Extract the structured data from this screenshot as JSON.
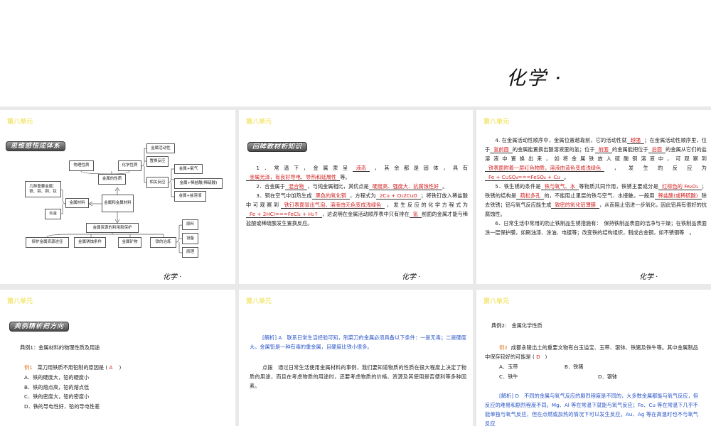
{
  "top": {
    "footer": "化学 ·"
  },
  "unit": "第八单元",
  "footer": "化学 ·",
  "slide1": {
    "badge": "思维感悟成体系",
    "boxes": {
      "activity": "金属活动性",
      "physical": "物理性质",
      "chemical": "化学性质",
      "replace": "置换反应",
      "oxygen": "金属+氧气",
      "props": "金属的性质",
      "reactions": "相关反应",
      "acid": "金属+稀盐酸(稀硫酸)",
      "metals": "几种重要金属：铁、铝、铜、钛",
      "salt": "金属+盐溶液",
      "center": "金属和金属材料",
      "materials": "金属材料",
      "alloy": "合金",
      "resources": "金属资源的利用和保护",
      "raw": "原料",
      "protect": "保护金属资源途径",
      "rust": "金属锈蚀条件",
      "ore": "金属矿物",
      "smelt": "铁的冶炼",
      "equipment": "设备",
      "principle": "原理"
    }
  },
  "slide2": {
    "badge": "回眸教材析知识",
    "paragraphs": [
      [
        {
          "t": "1．常温下，金属汞呈"
        },
        {
          "a": "液态"
        },
        {
          "t": "，其余都是固体，具有"
        },
        {
          "a": "金属光泽，有良好导电、导热和延展性"
        },
        {
          "t": "等。"
        }
      ],
      [
        {
          "t": "2．合金属于"
        },
        {
          "a": "混合物"
        },
        {
          "t": "，与纯金属相比，其优点是"
        },
        {
          "a": "硬度高、强度大、抗腐蚀性好"
        },
        {
          "t": "。"
        }
      ],
      [
        {
          "t": "3．铜在空气中加热生成"
        },
        {
          "a": "黑色的氧化铜"
        },
        {
          "t": "，方程式为"
        },
        {
          "a": "2Cu + O₂2CuO"
        },
        {
          "t": "；将铁钉放入稀盐酸中可观察到"
        },
        {
          "a": "铁钉表面冒出气泡，溶液由无色变成浅绿色"
        },
        {
          "t": "，发生反应的化学方程式为"
        },
        {
          "a": "Fe + 2HCl===FeCl₂ + H₂↑"
        },
        {
          "t": "，这说明在金属活动顺序表中只有排在"
        },
        {
          "a": "氢"
        },
        {
          "t": "前面的金属才能与稀盐酸或稀硫酸发生置换反应。"
        }
      ]
    ]
  },
  "slide3": {
    "paragraphs": [
      [
        {
          "t": "4. 在金属活动性顺序中，金属位置越靠前，它的活动性就"
        },
        {
          "a": "越强"
        },
        {
          "t": "；在金属活动性顺序里，位于"
        },
        {
          "a": "氢前面"
        },
        {
          "t": "的金属能置换出酸溶液里的氢；位于"
        },
        {
          "a": "前面"
        },
        {
          "t": "的金属能把位于"
        },
        {
          "a": "后面"
        },
        {
          "t": "的金属从它们的盐溶液中置换出来，如将金属铁放入硫酸铜溶液中，可观察到"
        },
        {
          "a": "铁表面附着一层红色物质，溶液由蓝色变成浅绿色"
        },
        {
          "t": "，发生的反应为"
        },
        {
          "a": "Fe + CuSO₄===FeSO₄ + Cu"
        },
        {
          "t": "。"
        }
      ],
      [
        {
          "t": "5．铁生锈的条件是"
        },
        {
          "a": "铁与氧气、水"
        },
        {
          "t": "等物质共同作用，铁锈主要成分是"
        },
        {
          "a": "红棕色的 Fe₂O₃"
        },
        {
          "t": "；铁锈的结构是"
        },
        {
          "a": "疏松多孔"
        },
        {
          "t": "的，不能阻止里层的铁与空气、水接触，一般用"
        },
        {
          "a": "稀盐酸(或稀硫酸)"
        },
        {
          "t": "除去铁锈；铝与氧气反应能生成"
        },
        {
          "a": "致密的氧化铝薄膜"
        },
        {
          "t": "，从而阻止铝进一步氧化，因此铝具有很好的抗腐蚀性。"
        }
      ],
      [
        {
          "t": "6．日常生活中常用的防止铁制品生锈措施有：　保持铁制品表面的洁净与干燥；在铁制品表面涂一层保护膜，如刷油漆、涂油、电镀等；改变铁的结构组织，制成合金钢，如不锈钢等　。"
        }
      ]
    ]
  },
  "slide4": {
    "badge": "典例精析把方向",
    "topic": "典例1：金属材料的物理性质及用途",
    "q_label": "例1",
    "question": "菜刀用铁质不用铅制的原因是 (",
    "answer": "A",
    "close": ")",
    "options": [
      "A．铁的硬度大，铅的硬度小",
      "B．铁的熔点高，铅的熔点低",
      "C．铁的密度大，铅的密度小",
      "D．铁的导电性好，铅的导电性差"
    ]
  },
  "slide5": {
    "analysis": "[解析] A　联系日常生活经验可知，制菜刀的金属必须具备以下条件：一是无毒；二是硬度大。金属铅是一种有毒的重金属，且硬度比铁小很多。",
    "tip": "点拨　通过日常生活使用金属材料的事例，我们要知道物质的性质在很大程度上决定了物质的用途，而且在考虑物质的用途时，还要考虑物质的价格、资源及其使用是否便利等多种因素。"
  },
  "slide6": {
    "topic": "典例2:　金属化学性质",
    "q_label": "例2",
    "question": "成都永陵出土的重要文物有白玉谥宝、玉带、银钵、铁猪及铁牛等。其中金属制品中保存较好的可能是 (",
    "answer": "D",
    "close": ")",
    "options": [
      "A．玉带",
      "B．铁猪",
      "C．铁牛",
      "D．银钵"
    ],
    "analysis": "[解析] D　不同的金属与氧气反应的剧烈程度是不同的，大多数金属都能与氧气反应，但反应的难易和剧烈程度不同。Mg、Al 等在常温下就能与氧气反应；Fe、Cu 等在常温下几乎不能单独与氧气反应，但在点燃或加热的情况下可以发生反应。Au、Ag 等在高温时也不与氧气反应"
  }
}
